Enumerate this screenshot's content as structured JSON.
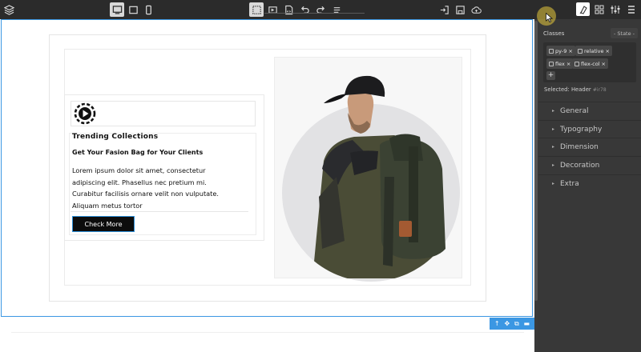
{
  "toolbar": {
    "left_icons": [
      "layers-icon"
    ],
    "device_icons": [
      "desktop-icon",
      "tablet-icon",
      "mobile-icon"
    ],
    "center_icons": [
      "outline-icon",
      "preview-icon",
      "code-icon",
      "undo-icon",
      "redo-icon",
      "menu-icon"
    ],
    "right_icons": [
      "import-icon",
      "save-icon",
      "cloud-upload-icon"
    ]
  },
  "content": {
    "title": "Trending Collections",
    "subtitle": "Get Your Fasion Bag for Your Clients",
    "body_lines": [
      "Lorem ipsum dolor sit amet, consectetur",
      "adipiscing elit. Phasellus nec pretium mi.",
      "Curabitur facilisis ornare velit non vulputate.",
      "Aliquam metus tortor"
    ],
    "cta_label": "Check More",
    "image": "person-with-backpack-image"
  },
  "selection_toolbar": {
    "icons": [
      "arrow-up-icon",
      "move-icon",
      "copy-icon",
      "delete-icon"
    ]
  },
  "panel": {
    "tabs": [
      "style-manager-icon",
      "blocks-icon",
      "settings-icon",
      "layer-manager-icon"
    ],
    "classes_label": "Classes",
    "state_label": "- State -",
    "tags": [
      "py-9",
      "relative",
      "flex",
      "flex-col"
    ],
    "add_label": "+",
    "selected_label": "Selected:",
    "selected_value": "Header",
    "selected_id": "#ir78",
    "sections": [
      "General",
      "Typography",
      "Dimension",
      "Decoration",
      "Extra"
    ]
  },
  "colors": {
    "accent": "#3b97e3",
    "panel_bg": "#383838",
    "toolbar_bg": "#2b2b2b",
    "cta_bg": "#0c0c0c"
  }
}
